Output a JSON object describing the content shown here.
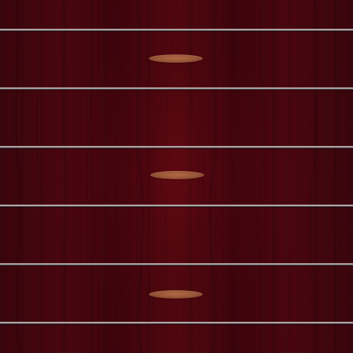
{
  "colors": {
    "background": "#4a0710",
    "grain_dark": "#2b0308",
    "shelf_line": "#cfc4c6",
    "handle": "#a8613f"
  },
  "icons": {
    "handles": [
      "drawer-handle-icon",
      "drawer-handle-icon",
      "drawer-handle-icon"
    ]
  }
}
